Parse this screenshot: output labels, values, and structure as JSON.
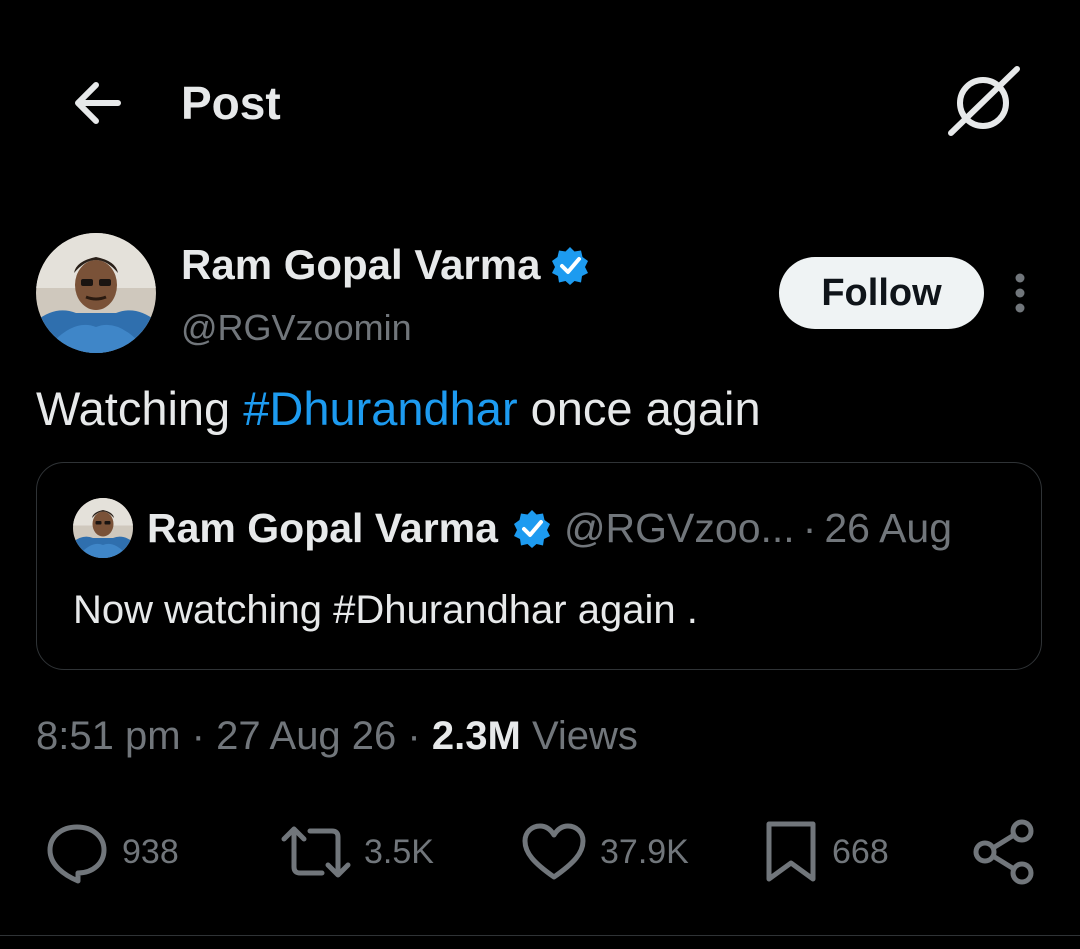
{
  "header": {
    "title": "Post",
    "back_icon": "arrow-left-icon",
    "grok_icon": "grok-icon"
  },
  "author": {
    "name": "Ram Gopal Varma",
    "handle": "@RGVzoomin",
    "verified": true,
    "follow_label": "Follow"
  },
  "tweet": {
    "text_before": "Watching ",
    "hashtag": "#Dhurandhar",
    "text_after": " once again"
  },
  "quote": {
    "name": "Ram Gopal Varma",
    "handle": "@RGVzoo...",
    "separator": "·",
    "date": "26 Aug",
    "text": "Now watching #Dhurandhar again ."
  },
  "meta": {
    "time": "8:51 pm",
    "sep1": "·",
    "date": "27 Aug 26",
    "sep2": "·",
    "views_count": "2.3M",
    "views_label": "Views"
  },
  "actions": {
    "replies": "938",
    "reposts": "3.5K",
    "likes": "37.9K",
    "bookmarks": "668"
  },
  "colors": {
    "background": "#000000",
    "text_primary": "#e7e9ea",
    "text_secondary": "#71767b",
    "accent": "#1d9bf0",
    "border": "#2f3336",
    "follow_bg": "#eff3f4"
  }
}
